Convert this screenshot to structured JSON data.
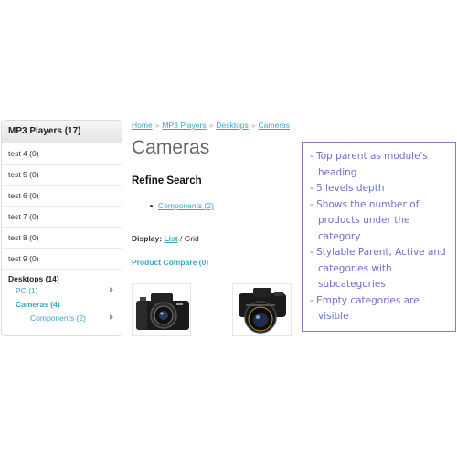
{
  "sidebar": {
    "heading": "MP3 Players (17)",
    "items": [
      {
        "label": "test 4 (0)"
      },
      {
        "label": "test 5 (0)"
      },
      {
        "label": "test 6 (0)"
      },
      {
        "label": "test 7 (0)"
      },
      {
        "label": "test 8 (0)"
      },
      {
        "label": "test 9 (0)"
      }
    ],
    "tree": {
      "parent": "Desktops (14)",
      "children": [
        {
          "label": "PC (1)"
        },
        {
          "label": "Cameras (4)"
        },
        {
          "label": "Components (2)"
        }
      ]
    }
  },
  "breadcrumb": {
    "items": [
      "Home",
      "MP3 Players",
      "Desktops",
      "Cameras"
    ],
    "separator": "»"
  },
  "main": {
    "title": "Cameras",
    "refine_title": "Refine Search",
    "refine_items": [
      {
        "label": "Components (2)"
      }
    ],
    "display_label": "Display:",
    "display_list": "List",
    "display_sep": "/",
    "display_grid": "Grid",
    "compare": "Product Compare (0)"
  },
  "products": [
    {
      "image": "camera-icon"
    },
    {
      "image": "camera-icon"
    }
  ],
  "callout": {
    "items": [
      "- Top parent as module's heading",
      "- 5 levels depth",
      "- Shows the number of products under the category",
      "- Stylable Parent, Active and categories with subcategories",
      "- Empty categories are visible"
    ]
  },
  "colors": {
    "link": "#3aa6c4",
    "callout": "#6b6fcf",
    "callout_border": "#7b7fd0"
  }
}
